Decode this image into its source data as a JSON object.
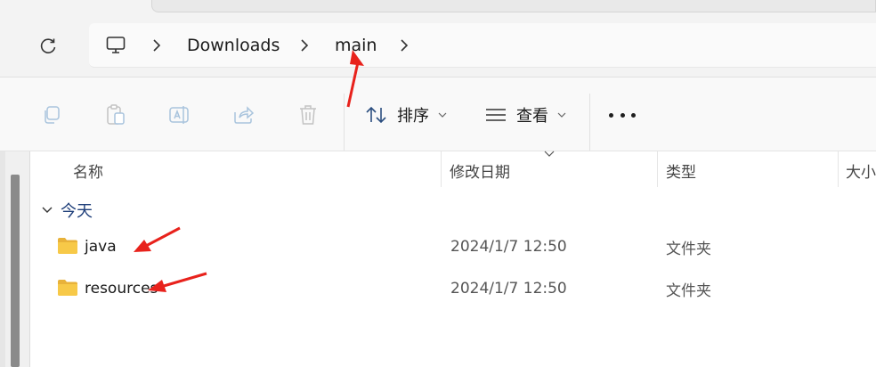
{
  "address": {
    "crumbs": [
      "Downloads",
      "main"
    ]
  },
  "toolbar": {
    "sort_label": "排序",
    "view_label": "查看"
  },
  "columns": {
    "name": "名称",
    "date": "修改日期",
    "type": "类型",
    "size": "大小"
  },
  "group": {
    "label": "今天"
  },
  "files": [
    {
      "name": "java",
      "date": "2024/1/7 12:50",
      "type": "文件夹"
    },
    {
      "name": "resources",
      "date": "2024/1/7 12:50",
      "type": "文件夹"
    }
  ],
  "colors": {
    "accent_arrow": "#e8221c",
    "folder": "#f7c948"
  }
}
